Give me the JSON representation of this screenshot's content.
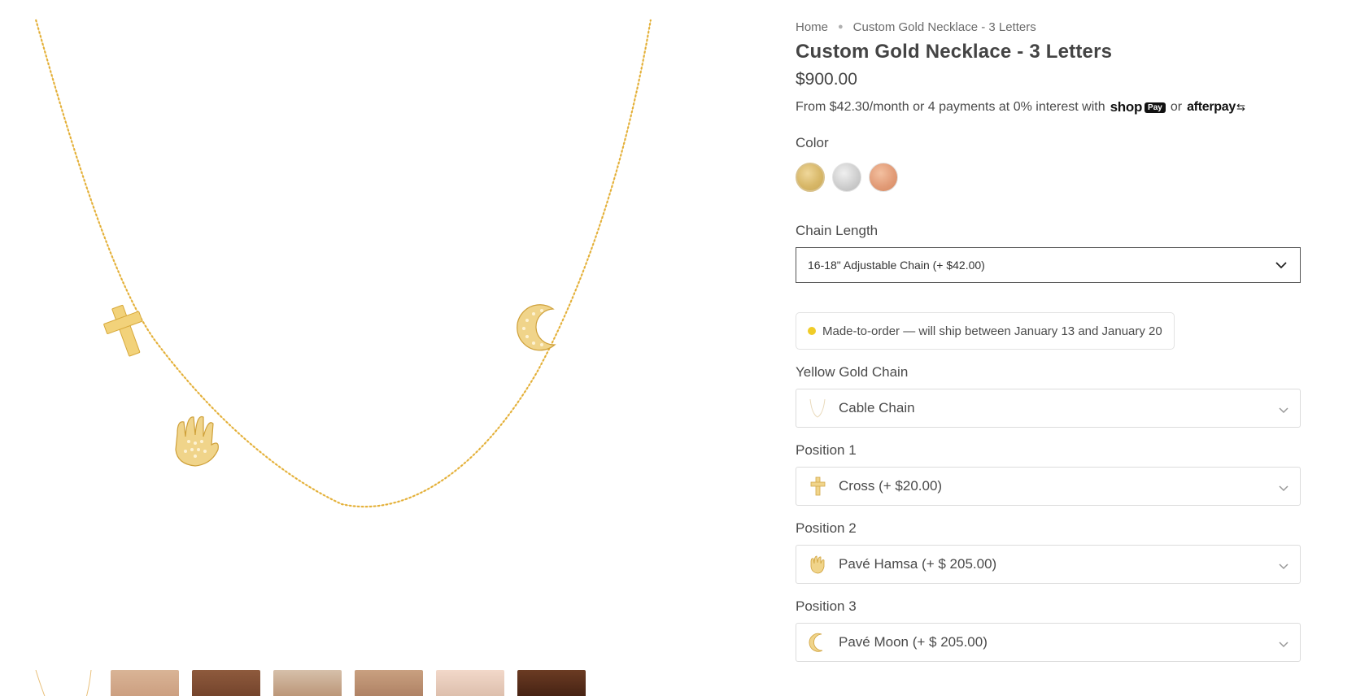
{
  "breadcrumb": {
    "home": "Home",
    "current": "Custom Gold Necklace - 3 Letters"
  },
  "product": {
    "title": "Custom Gold Necklace - 3 Letters",
    "price": "$900.00",
    "installments_text": "From $42.30/month or 4 payments at 0% interest with",
    "shop_label": "shop",
    "pay_badge": "Pay",
    "or_text": "or",
    "afterpay_label": "afterpay"
  },
  "color": {
    "label": "Color",
    "swatches": [
      {
        "name": "gold",
        "hex": "#d8b869"
      },
      {
        "name": "silver",
        "hex": "#cfcfcf"
      },
      {
        "name": "rose",
        "hex": "#e29c78"
      }
    ]
  },
  "chain_length": {
    "label": "Chain Length",
    "value": "16-18\" Adjustable Chain (+ $42.00)"
  },
  "shipping_note": "Made-to-order — will ship between January 13 and January 20",
  "options": {
    "chain": {
      "label": "Yellow Gold Chain",
      "value": "Cable Chain",
      "icon": "chain-icon"
    },
    "position1": {
      "label": "Position 1",
      "value": "Cross (+ $20.00)",
      "icon": "cross-icon"
    },
    "position2": {
      "label": "Position 2",
      "value": "Pavé Hamsa (+ $ 205.00)",
      "icon": "hamsa-icon"
    },
    "position3": {
      "label": "Position 3",
      "value": "Pavé Moon (+ $ 205.00)",
      "icon": "moon-icon"
    }
  },
  "colors": {
    "gold": "#e4b43a",
    "accent_dot": "#f0cc28",
    "text": "#4a4a4a"
  }
}
